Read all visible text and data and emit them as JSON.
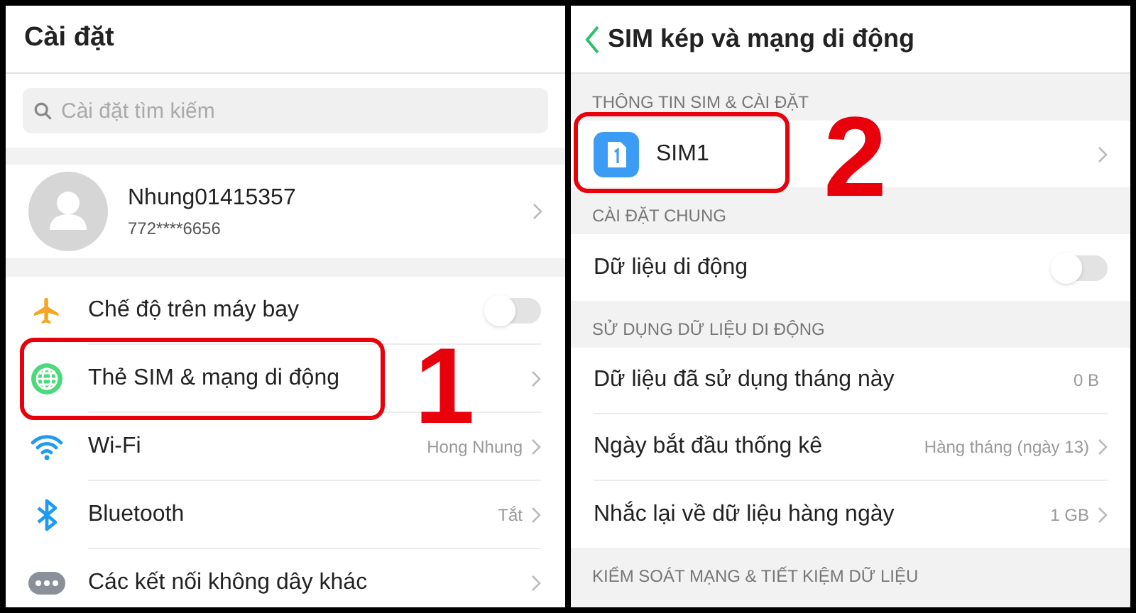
{
  "left_screen": {
    "title": "Cài đặt",
    "search": {
      "placeholder": "Cài đặt tìm kiếm"
    },
    "profile": {
      "name": "Nhung01415357",
      "phone": "772****6656"
    },
    "items": [
      {
        "kind": "toggle",
        "label": "Chế độ trên máy bay",
        "on": false
      },
      {
        "kind": "link",
        "label": "Thẻ SIM & mạng di động",
        "callout": "1"
      },
      {
        "kind": "link",
        "label": "Wi-Fi",
        "value": "Hong Nhung"
      },
      {
        "kind": "link",
        "label": "Bluetooth",
        "value": "Tắt"
      },
      {
        "kind": "link",
        "label": "Các kết nối không dây khác"
      }
    ]
  },
  "right_screen": {
    "title": "SIM kép và mạng di động",
    "sections": [
      {
        "header": "THÔNG TIN SIM & CÀI ĐẶT",
        "items": [
          {
            "kind": "sim",
            "label": "SIM1",
            "callout": "2"
          }
        ]
      },
      {
        "header": "CÀI ĐẶT CHUNG",
        "items": [
          {
            "kind": "toggle",
            "label": "Dữ liệu di động",
            "on": false
          }
        ]
      },
      {
        "header": "SỬ DỤNG DỮ LIỆU DI ĐỘNG",
        "items": [
          {
            "kind": "value",
            "label": "Dữ liệu đã sử dụng tháng này",
            "value": "0 B"
          },
          {
            "kind": "link",
            "label": "Ngày bắt đầu thống kê",
            "value": "Hàng tháng (ngày 13)"
          },
          {
            "kind": "link",
            "label": "Nhắc lại về dữ liệu hàng ngày",
            "value": "1 GB"
          }
        ]
      },
      {
        "header": "KIỂM SOÁT MẠNG & TIẾT KIỆM DỮ LIỆU"
      }
    ]
  }
}
